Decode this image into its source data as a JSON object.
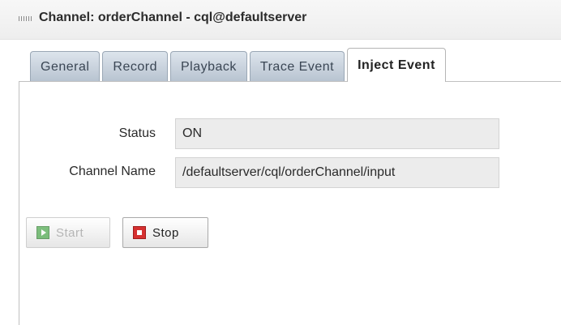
{
  "header": {
    "title": "Channel: orderChannel - cql@defaultserver"
  },
  "tabs": [
    {
      "label": "General"
    },
    {
      "label": "Record"
    },
    {
      "label": "Playback"
    },
    {
      "label": "Trace Event"
    },
    {
      "label": "Inject Event",
      "active": true
    }
  ],
  "form": {
    "status_label": "Status",
    "status_value": "ON",
    "channel_name_label": "Channel Name",
    "channel_name_value": "/defaultserver/cql/orderChannel/input"
  },
  "buttons": {
    "start_label": "Start",
    "start_enabled": false,
    "stop_label": "Stop",
    "stop_enabled": true
  }
}
